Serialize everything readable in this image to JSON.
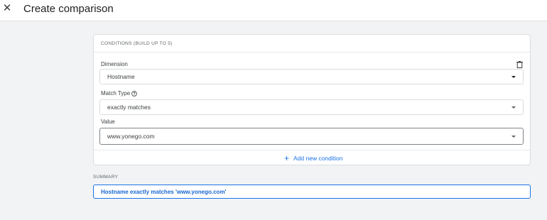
{
  "header": {
    "close_icon": "close-icon",
    "title": "Create comparison"
  },
  "conditions": {
    "heading": "CONDITIONS (BUILD UP TO 5)",
    "dimension": {
      "label": "Dimension",
      "value": "Hostname",
      "delete_icon": "trash-icon"
    },
    "match_type": {
      "label": "Match Type",
      "help_icon": "help-circle-icon",
      "value": "exactly matches"
    },
    "value_field": {
      "label": "Value",
      "value": "www.yonego.com"
    },
    "add_condition_label": "Add new condition"
  },
  "summary": {
    "label": "SUMMARY",
    "text": "Hostname exactly matches 'www.yonego.com'"
  },
  "colors": {
    "accent": "#1a73e8",
    "background": "#f1f3f4",
    "card": "#ffffff"
  }
}
